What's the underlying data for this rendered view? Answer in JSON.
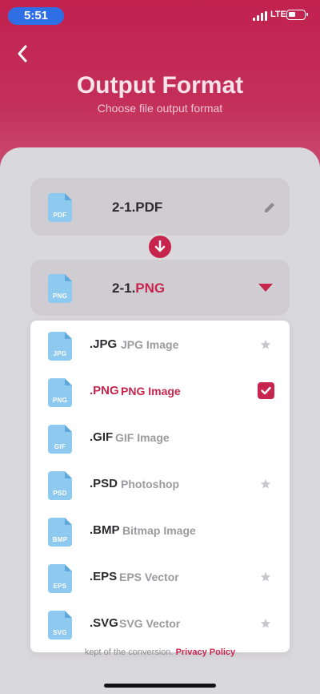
{
  "status_bar": {
    "time": "5:51",
    "network": "LTE"
  },
  "header": {
    "title": "Output Format",
    "subtitle": "Choose file output format"
  },
  "source_file": {
    "name": "2-1.PDF",
    "icon_label": "PDF",
    "icon": "pdf-file-icon"
  },
  "target_file": {
    "base": "2-1.",
    "ext": "PNG",
    "icon_label": "PNG",
    "icon": "png-file-icon"
  },
  "formats": [
    {
      "ext": ".JPG",
      "desc": "JPG Image",
      "icon_label": "JPG",
      "selected": false,
      "star": true
    },
    {
      "ext": ".PNG",
      "desc": "PNG Image",
      "icon_label": "PNG",
      "selected": true,
      "star": false
    },
    {
      "ext": ".GIF",
      "desc": "GIF Image",
      "icon_label": "GIF",
      "selected": false,
      "star": false
    },
    {
      "ext": ".PSD",
      "desc": "Photoshop",
      "icon_label": "PSD",
      "selected": false,
      "star": true
    },
    {
      "ext": ".BMP",
      "desc": "Bitmap Image",
      "icon_label": "BMP",
      "selected": false,
      "star": false
    },
    {
      "ext": ".EPS",
      "desc": "EPS Vector",
      "icon_label": "EPS",
      "selected": false,
      "star": true
    },
    {
      "ext": ".SVG",
      "desc": "SVG Vector",
      "icon_label": "SVG",
      "selected": false,
      "star": true
    }
  ],
  "footer": {
    "text": "kept of the conversion.",
    "link": "Privacy Policy"
  },
  "colors": {
    "accent": "#c7254e",
    "hero": "#c2214e",
    "sheet": "#d9d8dc",
    "icon": "#8ec9ef"
  }
}
